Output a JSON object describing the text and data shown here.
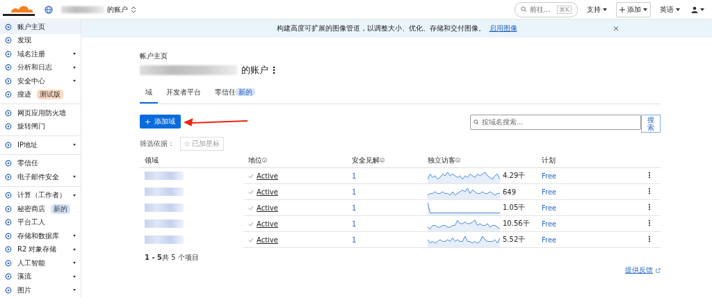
{
  "topbar": {
    "account_suffix": "的账户",
    "search_placeholder": "前往...",
    "search_shortcut": "⌘K",
    "menus": [
      {
        "label": "支持",
        "kind": "menu"
      },
      {
        "label": "添加",
        "kind": "add"
      },
      {
        "label": "英语",
        "kind": "menu"
      },
      {
        "kind": "user"
      }
    ]
  },
  "sidebar": {
    "groups": [
      [
        {
          "label": "账户主页",
          "selected": true,
          "expandable": false
        },
        {
          "label": "发现",
          "selected": false,
          "expandable": false
        },
        {
          "label": "域名注册",
          "selected": false,
          "expandable": true
        },
        {
          "label": "分析和日志",
          "selected": false,
          "expandable": true
        },
        {
          "label": "安全中心",
          "selected": false,
          "expandable": true
        },
        {
          "label": "搜迹",
          "selected": false,
          "expandable": false,
          "badge": {
            "text": "测试版",
            "color": "#fbd9c2"
          }
        }
      ],
      [
        {
          "label": "网页应用防火墙",
          "selected": false,
          "expandable": false
        },
        {
          "label": "旋转闸门",
          "selected": false,
          "expandable": false
        }
      ],
      [
        {
          "label": "IP地址",
          "selected": false,
          "expandable": true
        }
      ],
      [
        {
          "label": "零信任",
          "selected": false,
          "expandable": false
        },
        {
          "label": "电子邮件安全",
          "selected": false,
          "expandable": true
        }
      ],
      [
        {
          "label": "计算（工作者）",
          "selected": false,
          "expandable": true
        },
        {
          "label": "秘密商店",
          "selected": false,
          "expandable": false,
          "badge": {
            "text": "新的",
            "color": "#d3e3fa"
          }
        },
        {
          "label": "平台工人",
          "selected": false,
          "expandable": false
        },
        {
          "label": "存储和数据库",
          "selected": false,
          "expandable": true
        },
        {
          "label": "R2 对象存储",
          "selected": false,
          "expandable": true
        },
        {
          "label": "人工智能",
          "selected": false,
          "expandable": true
        },
        {
          "label": "溪流",
          "selected": false,
          "expandable": true
        },
        {
          "label": "图片",
          "selected": false,
          "expandable": true
        }
      ]
    ]
  },
  "banner": {
    "text": "构建高度可扩展的图像管道，以调整大小、优化、存储和交付图像。",
    "link": "启用图像"
  },
  "page": {
    "breadcrumb": "帐户主页",
    "title_suffix": "的账户",
    "tabs": [
      {
        "label": "域",
        "selected": true
      },
      {
        "label": "开发者平台",
        "selected": false
      },
      {
        "label": "零信任",
        "selected": false,
        "badge": "新的"
      }
    ],
    "add_button": "添加域",
    "search_placeholder": "按域名搜索...",
    "search_button": "搜索",
    "filter_label": "筛选依据：",
    "filter_chip": "已加星标"
  },
  "table": {
    "columns": [
      {
        "label": "领域",
        "info": false
      },
      {
        "label": "地位",
        "info": true
      },
      {
        "label": "安全见解",
        "info": true
      },
      {
        "label": "独立访客",
        "info": true
      },
      {
        "label": "计划",
        "info": false
      }
    ],
    "rows": [
      {
        "status": "Active",
        "insights": "1",
        "visitors": "4.29千",
        "plan": "Free"
      },
      {
        "status": "Active",
        "insights": "1",
        "visitors": "649",
        "plan": "Free"
      },
      {
        "status": "Active",
        "insights": "1",
        "visitors": "1.05千",
        "plan": "Free"
      },
      {
        "status": "Active",
        "insights": "1",
        "visitors": "10.56千",
        "plan": "Free"
      },
      {
        "status": "Active",
        "insights": "1",
        "visitors": "5.52千",
        "plan": "Free"
      }
    ],
    "pagination": "**1 - 5**共 5 个项目"
  },
  "feedback": "提供反馈"
}
